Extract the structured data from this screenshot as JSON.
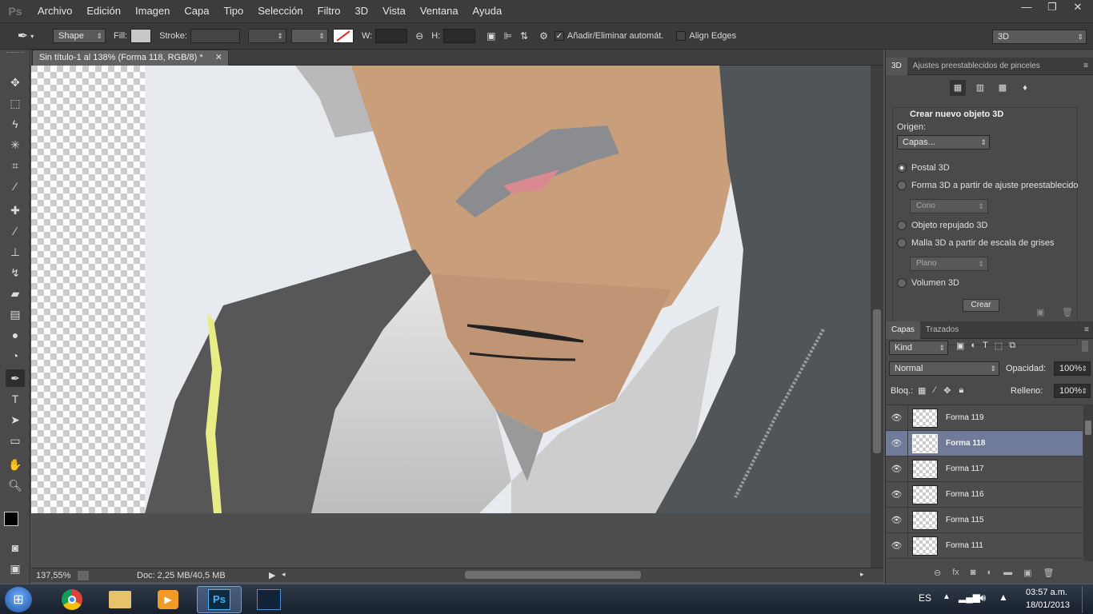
{
  "menu": {
    "logo": "Ps",
    "items": [
      "Archivo",
      "Edición",
      "Imagen",
      "Capa",
      "Tipo",
      "Selección",
      "Filtro",
      "3D",
      "Vista",
      "Ventana",
      "Ayuda"
    ],
    "window_controls": [
      "—",
      "❐",
      "✕"
    ]
  },
  "options": {
    "mode": "Shape",
    "fill_label": "Fill:",
    "stroke_label": "Stroke:",
    "w_label": "W:",
    "h_label": "H:",
    "auto_add": "Añadir/Eliminar automát.",
    "align_edges": "Align Edges",
    "workspace": "3D",
    "fill_color": "#c8c8c8",
    "stroke_color": "#ffffff"
  },
  "document": {
    "tab_title": "Sin título-1 al 138% (Forma 118, RGB/8) *",
    "zoom": "137,55%",
    "doc_info": "Doc: 2,25 MB/40,5 MB"
  },
  "panel_3d": {
    "tabs": [
      "3D",
      "Ajustes preestablecidos de pinceles"
    ],
    "section_title": "Crear nuevo objeto 3D",
    "origin_label": "Origen:",
    "origin_value": "Capas...",
    "options": [
      "Postal 3D",
      "Forma 3D a partir de ajuste preestablecido",
      "Objeto repujado 3D",
      "Malla 3D a partir de escala de grises",
      "Volumen 3D"
    ],
    "preset_value": "Cono",
    "grayscale_value": "Plano",
    "create_button": "Crear"
  },
  "layers_panel": {
    "tabs": [
      "Capas",
      "Trazados"
    ],
    "filter": "Kind",
    "blend_mode": "Normal",
    "opacity_label": "Opacidad:",
    "opacity_value": "100%",
    "lock_label": "Bloq.:",
    "fill_label": "Relleno:",
    "fill_value": "100%",
    "layers": [
      "Forma 119",
      "Forma 118",
      "Forma 117",
      "Forma 116",
      "Forma 115",
      "Forma 111"
    ],
    "selected_index": 1
  },
  "taskbar": {
    "lang": "ES",
    "time": "03:57 a.m.",
    "date": "18/01/2013"
  }
}
